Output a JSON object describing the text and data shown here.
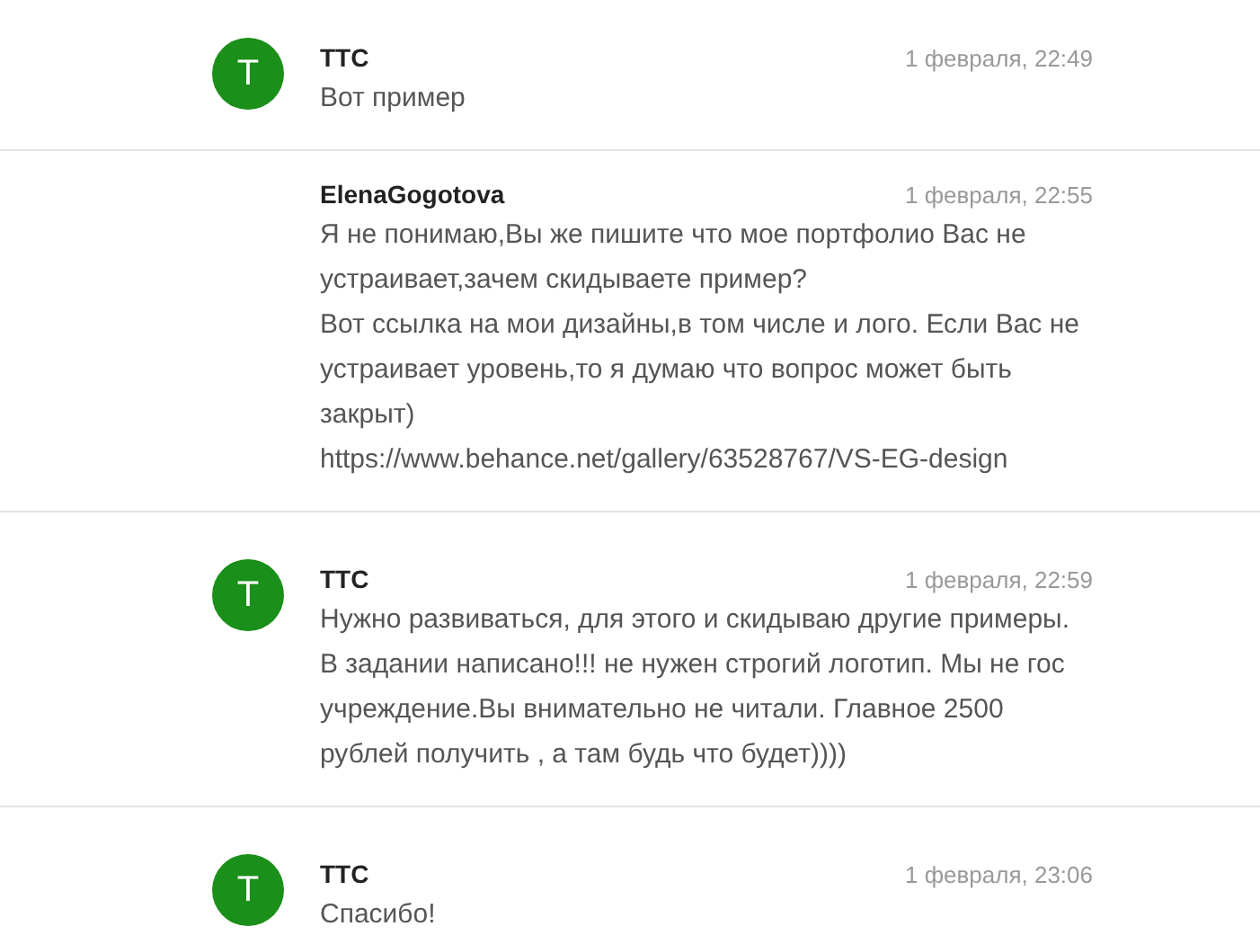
{
  "messages": [
    {
      "kind": "avatar",
      "avatar": "T",
      "author": "TTC",
      "time": "1 февраля, 22:49",
      "text": "Вот пример"
    },
    {
      "kind": "plain",
      "author": "ElenaGogotova",
      "time": "1 февраля, 22:55",
      "text": "Я не понимаю,Вы же пишите что мое портфолио Вас не устраивает,зачем скидываете пример?\nВот ссылка на мои дизайны,в том числе и лого. Если Вас не устраивает уровень,то я думаю что вопрос может быть закрыт)\nhttps://www.behance.net/gallery/63528767/VS-EG-design"
    },
    {
      "kind": "avatar",
      "avatar": "T",
      "author": "TTC",
      "time": "1 февраля, 22:59",
      "text": "Нужно развиваться, для этого и скидываю другие примеры. В задании написано!!! не нужен строгий логотип. Мы не гос учреждение.Вы внимательно не читали. Главное 2500 рублей получить , а там будь что будет))))"
    },
    {
      "kind": "avatar",
      "avatar": "T",
      "author": "TTC",
      "time": "1 февраля, 23:06",
      "text": "Спасибо!"
    }
  ]
}
